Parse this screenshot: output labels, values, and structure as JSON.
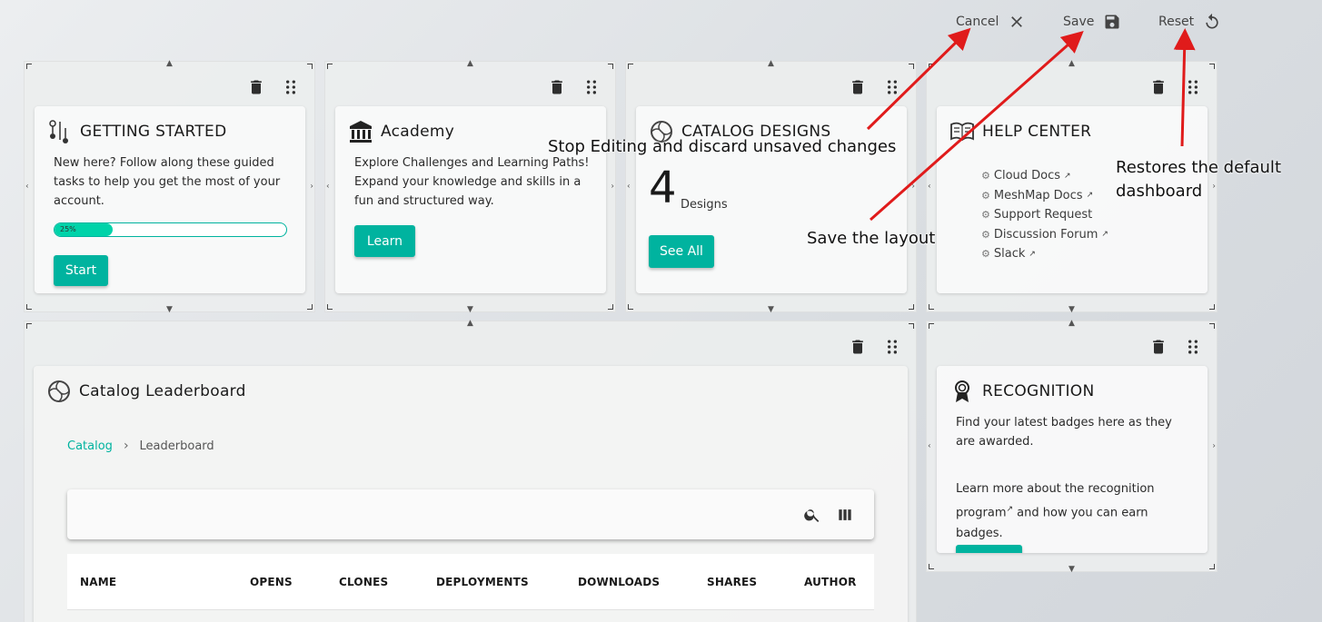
{
  "toolbar": {
    "cancel_label": "Cancel",
    "save_label": "Save",
    "reset_label": "Reset"
  },
  "widgets": {
    "getting_started": {
      "title": "GETTING STARTED",
      "text": "New here? Follow along these guided tasks to help you get the most of your account.",
      "progress_label": "25%",
      "progress_value": 0.25,
      "button": "Start"
    },
    "academy": {
      "title": "Academy",
      "text": "Explore Challenges and Learning Paths! Expand your knowledge and skills in a fun and structured way.",
      "button": "Learn"
    },
    "catalog_designs": {
      "title": "CATALOG DESIGNS",
      "count": "4",
      "count_label": "Designs",
      "button": "See All"
    },
    "help_center": {
      "title": "HELP CENTER",
      "links": [
        "Cloud Docs",
        "MeshMap Docs",
        "Support Request",
        "Discussion Forum",
        "Slack"
      ]
    },
    "leaderboard": {
      "title": "Catalog Leaderboard",
      "breadcrumb_root": "Catalog",
      "breadcrumb_current": "Leaderboard",
      "columns": [
        "NAME",
        "OPENS",
        "CLONES",
        "DEPLOYMENTS",
        "DOWNLOADS",
        "SHARES",
        "AUTHOR"
      ]
    },
    "recognition": {
      "title": "RECOGNITION",
      "text1": "Find your latest badges here as they are awarded.",
      "text2_pre": "Learn more about the recognition program",
      "text2_post": " and how you can earn badges."
    }
  },
  "annotations": {
    "cancel": "Stop Editing and discard unsaved changes",
    "save": "Save the layout",
    "reset_line1": "Restores the default",
    "reset_line2": "dashboard"
  },
  "colors": {
    "accent": "#00b39f",
    "arrow": "#e01b1b"
  }
}
